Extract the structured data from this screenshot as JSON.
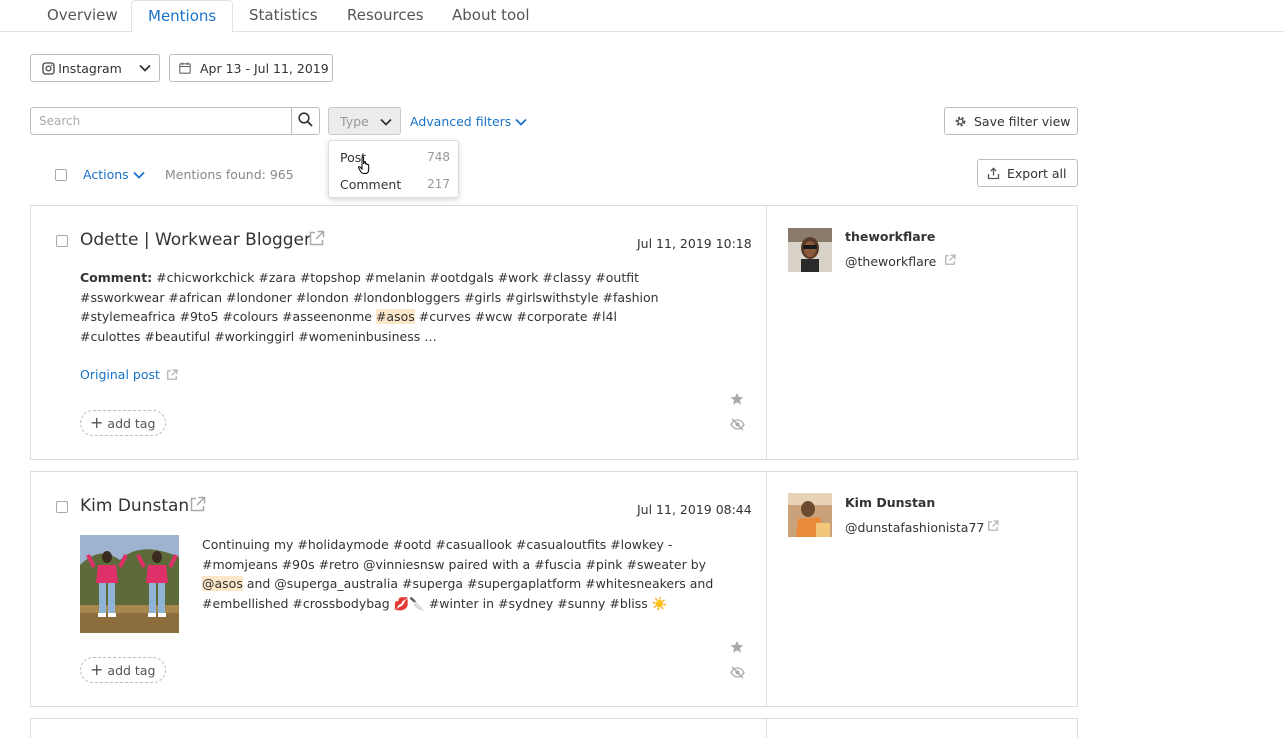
{
  "tabs": [
    {
      "label": "Overview"
    },
    {
      "label": "Mentions"
    },
    {
      "label": "Statistics"
    },
    {
      "label": "Resources"
    },
    {
      "label": "About tool"
    }
  ],
  "filters": {
    "source_label": "Instagram",
    "date_range": "Apr 13 - Jul 11, 2019",
    "search_placeholder": "Search",
    "type_label": "Type",
    "advanced_filters": "Advanced filters",
    "save_filter_view": "Save filter view"
  },
  "type_dropdown": {
    "items": [
      {
        "label": "Post",
        "count": "748"
      },
      {
        "label": "Comment",
        "count": "217"
      }
    ]
  },
  "toolbar": {
    "actions_label": "Actions",
    "mentions_found": "Mentions found: 965",
    "export_all": "Export all"
  },
  "mentions": [
    {
      "title": "Odette | Workwear Blogger",
      "date": "Jul 11, 2019 10:18",
      "comment_label": "Comment:",
      "text_before": " #chicworkchick #zara #topshop #melanin #ootdgals #work #classy #outfit #sswork­wear #african #londoner #london #londonbloggers #girls #girlswithstyle #fashion #stylemeafrica #9to5 #colours #asseenonme ",
      "highlight": "#asos",
      "text_after": " #curves #wcw #corporate #l4l #culottes #beautiful #workinggirl #womeninbusiness …",
      "original_post": "Original post",
      "add_tag": "add tag",
      "author_name": "theworkflare",
      "author_handle": "@theworkflare"
    },
    {
      "title": "Kim Dunstan",
      "date": "Jul 11, 2019 08:44",
      "text_before": "Continuing my #holidaymode #ootd #casuallook #casualoutfits #lowkey - #momjeans #90s #retro @vinniesnsw paired with a #fuscia #pink #sweater by ",
      "highlight": "@asos",
      "text_after": " and @superga_australia #superga #supergaplatform #whitesneakers and #embellished #crossbodybag 💋🔪 #winter in #sydney #sunny #bliss ☀️",
      "add_tag": "add tag",
      "author_name": "Kim Dunstan",
      "author_handle": "@dunstafashionista77"
    }
  ],
  "colors": {
    "accent": "#1a73c8",
    "highlight": "#fde7c9",
    "border": "#dcdcdc"
  }
}
